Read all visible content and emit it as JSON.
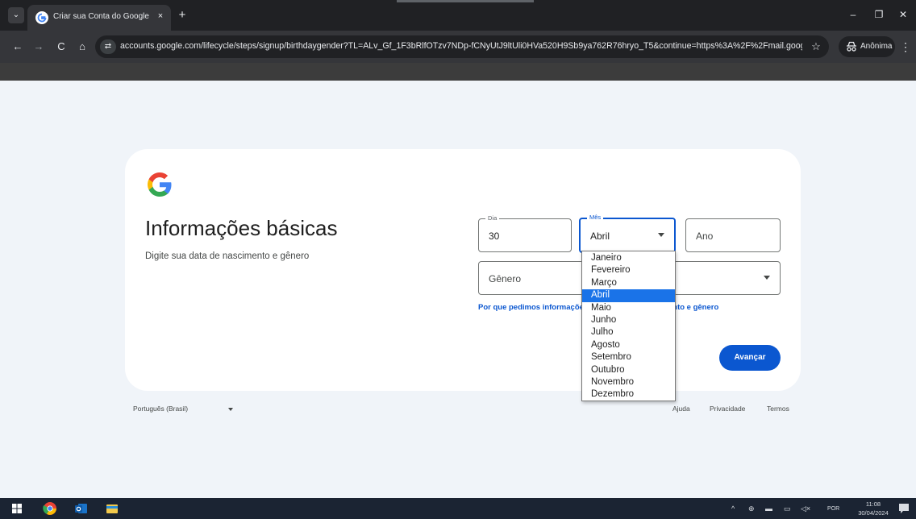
{
  "browser": {
    "tab_title": "Criar sua Conta do Google",
    "tab_close": "×",
    "new_tab": "+",
    "url": "accounts.google.com/lifecycle/steps/signup/birthdaygender?TL=ALv_Gf_1F3bRlfOTzv7NDp-fCNyUtJ9ltUli0HVa520H9Sb9ya762R76hryo_T5&continue=https%3A%2F%2Fmail.google.com...",
    "profile_label": "Anônima",
    "window_controls": {
      "minimize": "‒",
      "maximize": "❐",
      "close": "✕"
    },
    "nav": {
      "back": "←",
      "forward": "→",
      "reload": "C",
      "home": "⌂",
      "star": "☆",
      "menu": "⋮"
    }
  },
  "card": {
    "title": "Informações básicas",
    "subtitle": "Digite sua data de nascimento e gênero",
    "day": {
      "label": "Dia",
      "value": "30"
    },
    "month": {
      "label": "Mês",
      "value": "Abril"
    },
    "year": {
      "placeholder": "Ano"
    },
    "gender": {
      "placeholder": "Gênero"
    },
    "why_link": "Por que pedimos informações sobre data de nascimento e gênero",
    "next_button": "Avançar"
  },
  "month_dropdown": {
    "options": [
      "Janeiro",
      "Fevereiro",
      "Março",
      "Abril",
      "Maio",
      "Junho",
      "Julho",
      "Agosto",
      "Setembro",
      "Outubro",
      "Novembro",
      "Dezembro"
    ],
    "selected": "Abril"
  },
  "footer": {
    "language": "Português (Brasil)",
    "help": "Ajuda",
    "privacy": "Privacidade",
    "terms": "Termos"
  },
  "taskbar": {
    "lang": "POR",
    "time": "11:08",
    "date": "30/04/2024"
  },
  "colors": {
    "accent": "#0b57d0",
    "selected_option": "#1a73e8",
    "page_bg": "#f0f4f9"
  }
}
